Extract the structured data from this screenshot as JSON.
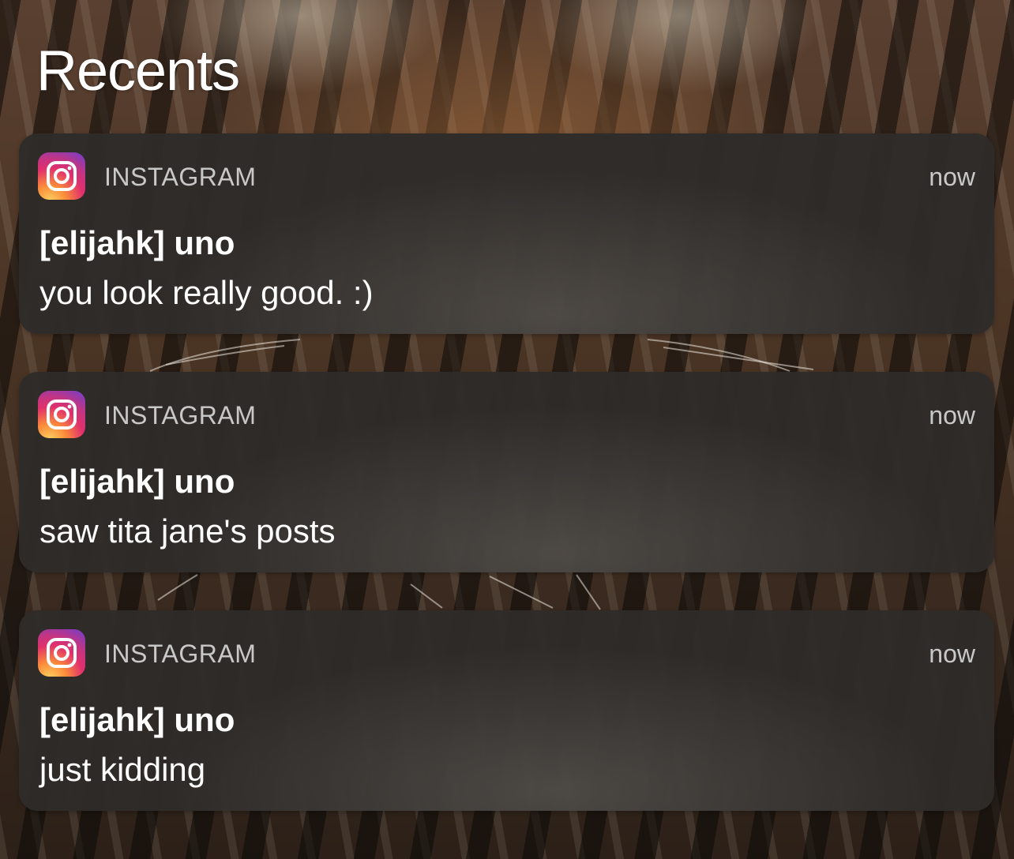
{
  "header": {
    "title": "Recents"
  },
  "notifications": [
    {
      "app_icon": "instagram-icon",
      "app_name": "INSTAGRAM",
      "time": "now",
      "sender": "[elijahk] uno",
      "message": "you look really good. :)"
    },
    {
      "app_icon": "instagram-icon",
      "app_name": "INSTAGRAM",
      "time": "now",
      "sender": "[elijahk] uno",
      "message": "saw tita jane's posts"
    },
    {
      "app_icon": "instagram-icon",
      "app_name": "INSTAGRAM",
      "time": "now",
      "sender": "[elijahk] uno",
      "message": "just kidding"
    }
  ],
  "colors": {
    "card_background": "#35322f",
    "text_primary": "#ffffff",
    "text_secondary": "#dcdcdc",
    "instagram_gradient": [
      "#fdd462",
      "#fb8a3a",
      "#e1306c",
      "#c13584",
      "#6b3fd1"
    ]
  }
}
